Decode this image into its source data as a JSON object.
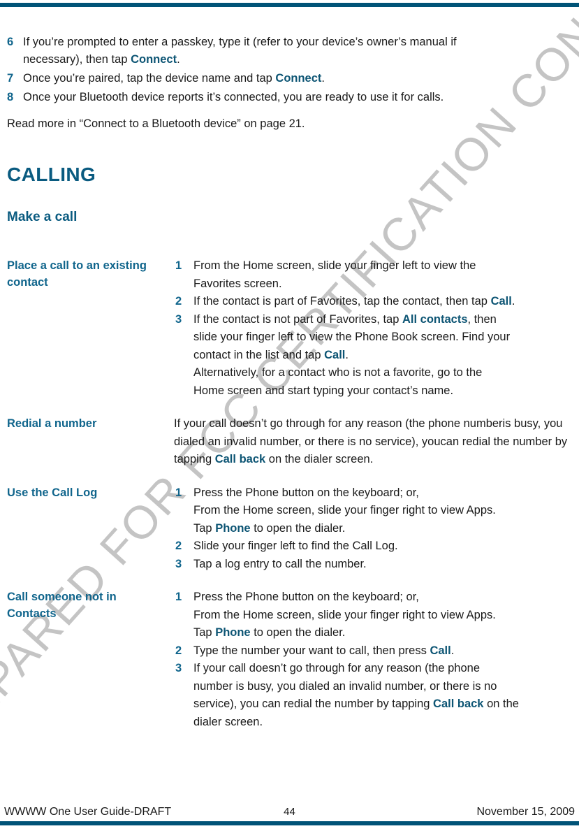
{
  "document": {
    "top_rule_color": "#005377",
    "bottom_rule_color": "#005377",
    "heading_color": "#0a5b80",
    "accent_color": "#10658c",
    "inline_term_color": "#0d5574",
    "watermark": "PREPARED FOR FCC CERTIFICATION CONFIDENTIAL"
  },
  "intro_steps": [
    {
      "number": "6",
      "lines": [
        "If you’re prompted to enter a passkey, type it (refer to your device’s owner’s manual if",
        "necessary), then tap "
      ],
      "term": "Connect",
      "tail": "."
    },
    {
      "number": "7",
      "lines": [
        "Once you’re paired, tap the device name and tap "
      ],
      "term": "Connect",
      "tail": "."
    },
    {
      "number": "8",
      "lines": [
        "Once your Bluetooth device reports it’s connected, you are ready to use it for calls."
      ],
      "term": "",
      "tail": ""
    }
  ],
  "read_more": "Read more in “Connect to a Bluetooth device” on page 21.",
  "section_title": "CALLING",
  "subsection_title": "Make a call",
  "rows": [
    {
      "term": "Place a call to an existing contact",
      "kind": "list",
      "items": [
        {
          "number": "1",
          "segments": [
            {
              "text": "From the Home screen, slide your finger left to view the",
              "style": "plain",
              "br": true
            },
            {
              "text": "Favorites screen.",
              "style": "plain",
              "br": false
            }
          ]
        },
        {
          "number": "2",
          "segments": [
            {
              "text": "If the contact is part of Favorites, tap the contact, then tap ",
              "style": "plain",
              "br": false
            },
            {
              "text": "Call",
              "style": "ui",
              "br": false
            },
            {
              "text": ".",
              "style": "plain",
              "br": false
            }
          ]
        },
        {
          "number": "3",
          "segments": [
            {
              "text": "If the contact is not part of Favorites, tap ",
              "style": "plain",
              "br": false
            },
            {
              "text": "All contacts",
              "style": "ui",
              "br": false
            },
            {
              "text": ", then",
              "style": "plain",
              "br": true
            },
            {
              "text": "slide your finger left to view the Phone Book screen. Find your",
              "style": "plain",
              "br": true
            },
            {
              "text": "contact in the list and tap ",
              "style": "plain",
              "br": false
            },
            {
              "text": "Call",
              "style": "ui",
              "br": false
            },
            {
              "text": ".",
              "style": "plain",
              "br": true
            },
            {
              "text": "Alternatively, for a contact who is not a favorite, go to the",
              "style": "plain",
              "br": true
            },
            {
              "text": "Home screen and start typing your contact’s name.",
              "style": "plain",
              "br": false
            }
          ]
        }
      ]
    },
    {
      "term": "Redial a number",
      "kind": "para",
      "segments": [
        {
          "text": "If your call doesn’t go through for any reason (the phone number",
          "style": "plain",
          "br": true
        },
        {
          "text": "is busy, you dialed an invalid number, or there is no service), you",
          "style": "plain",
          "br": true
        },
        {
          "text": "can redial the number by tapping ",
          "style": "plain",
          "br": false
        },
        {
          "text": "Call back",
          "style": "ui",
          "br": false
        },
        {
          "text": " on the dialer screen.",
          "style": "plain",
          "br": false
        }
      ]
    },
    {
      "term": "Use the Call Log",
      "kind": "list",
      "items": [
        {
          "number": "1",
          "segments": [
            {
              "text": "Press the Phone button on the keyboard; or,",
              "style": "plain",
              "br": true
            },
            {
              "text": "From the Home screen, slide your finger right to view Apps.",
              "style": "plain",
              "br": true
            },
            {
              "text": "Tap ",
              "style": "plain",
              "br": false
            },
            {
              "text": "Phone",
              "style": "ui",
              "br": false
            },
            {
              "text": " to open the dialer.",
              "style": "plain",
              "br": false
            }
          ]
        },
        {
          "number": "2",
          "segments": [
            {
              "text": "Slide your finger left to find the Call Log.",
              "style": "plain",
              "br": false
            }
          ]
        },
        {
          "number": "3",
          "segments": [
            {
              "text": "Tap a log entry to call the number.",
              "style": "plain",
              "br": false
            }
          ]
        }
      ]
    },
    {
      "term": "Call someone not in Contacts",
      "kind": "list",
      "items": [
        {
          "number": "1",
          "segments": [
            {
              "text": "Press the Phone button on the keyboard; or,",
              "style": "plain",
              "br": true
            },
            {
              "text": "From the Home screen, slide your finger right to view Apps.",
              "style": "plain",
              "br": true
            },
            {
              "text": "Tap ",
              "style": "plain",
              "br": false
            },
            {
              "text": "Phone",
              "style": "ui",
              "br": false
            },
            {
              "text": " to open the dialer.",
              "style": "plain",
              "br": false
            }
          ]
        },
        {
          "number": "2",
          "segments": [
            {
              "text": "Type the number your want to call, then press ",
              "style": "plain",
              "br": false
            },
            {
              "text": "Call",
              "style": "ui",
              "br": false
            },
            {
              "text": ".",
              "style": "plain",
              "br": false
            }
          ]
        },
        {
          "number": "3",
          "segments": [
            {
              "text": "If your call doesn’t go through for any reason (the phone",
              "style": "plain",
              "br": true
            },
            {
              "text": "number is busy, you dialed an invalid number, or there is no",
              "style": "plain",
              "br": true
            },
            {
              "text": "service), you can redial the number by tapping ",
              "style": "plain",
              "br": false
            },
            {
              "text": "Call back",
              "style": "ui",
              "br": false
            },
            {
              "text": " on the",
              "style": "plain",
              "br": true
            },
            {
              "text": "dialer screen.",
              "style": "plain",
              "br": false
            }
          ]
        }
      ]
    }
  ],
  "footer": {
    "left": "WWWW One User Guide-DRAFT",
    "page_number": "44",
    "right": "November 15, 2009"
  }
}
